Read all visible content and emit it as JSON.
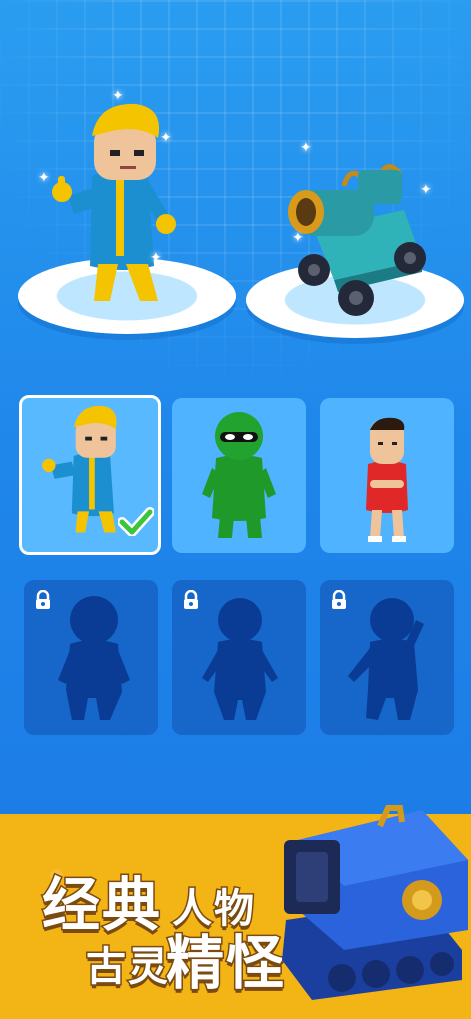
{
  "banner": {
    "line1_big": "经典",
    "line1_small": "人物",
    "line2_small": "古灵",
    "line2_big": "精怪"
  },
  "featured": {
    "character_icon": "yellow-hair-hero-figure",
    "vehicle_icon": "cannon-car-figure"
  },
  "roster": [
    {
      "name": "blonde-hero",
      "state": "selected",
      "icon": "check-icon"
    },
    {
      "name": "green-masked",
      "state": "unlocked"
    },
    {
      "name": "red-shirt-kid",
      "state": "unlocked"
    },
    {
      "name": "locked-1",
      "state": "locked",
      "icon": "lock-icon"
    },
    {
      "name": "locked-2",
      "state": "locked",
      "icon": "lock-icon"
    },
    {
      "name": "locked-3",
      "state": "locked",
      "icon": "lock-icon"
    }
  ],
  "colors": {
    "background": "#1f86ea",
    "card": "#4fb3ff",
    "locked_card": "#1667c9",
    "banner": "#f3b416",
    "check": "#3ac53a"
  }
}
